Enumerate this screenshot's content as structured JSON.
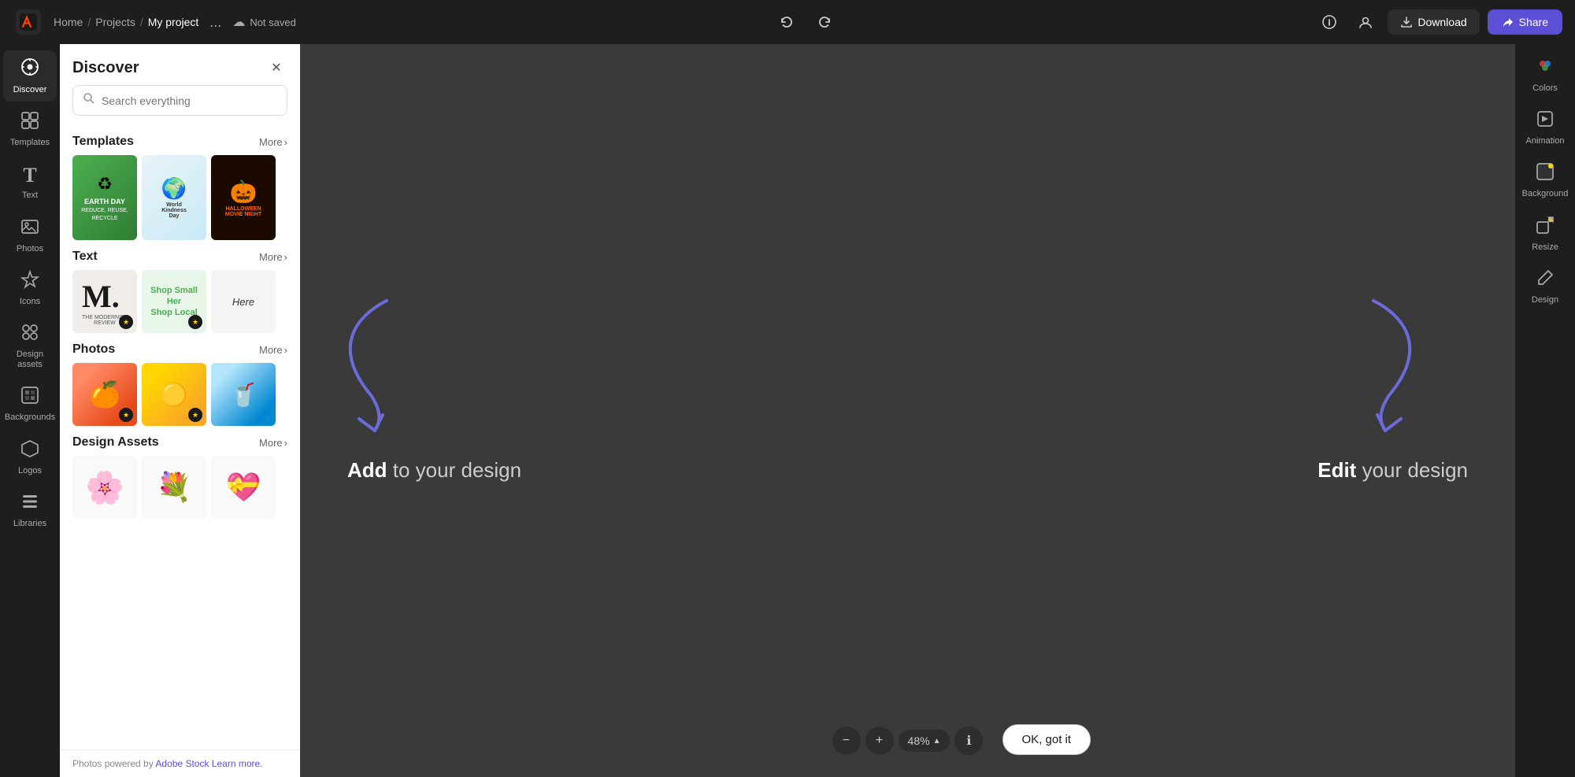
{
  "topbar": {
    "logo_alt": "Adobe Express Logo",
    "nav_home": "Home",
    "nav_sep1": "/",
    "nav_projects": "Projects",
    "nav_sep2": "/",
    "nav_current": "My project",
    "nav_more": "...",
    "save_status": "Not saved",
    "download_label": "Download",
    "share_label": "Share"
  },
  "left_sidebar": {
    "items": [
      {
        "id": "discover",
        "label": "Discover",
        "icon": "⊕",
        "active": true
      },
      {
        "id": "templates",
        "label": "Templates",
        "icon": "⊞"
      },
      {
        "id": "text",
        "label": "Text",
        "icon": "T"
      },
      {
        "id": "photos",
        "label": "Photos",
        "icon": "⬜"
      },
      {
        "id": "icons",
        "label": "Icons",
        "icon": "✦"
      },
      {
        "id": "design-assets",
        "label": "Design assets",
        "icon": "🎨"
      },
      {
        "id": "backgrounds",
        "label": "Backgrounds",
        "icon": "▦"
      },
      {
        "id": "logos",
        "label": "Logos",
        "icon": "⬡"
      },
      {
        "id": "libraries",
        "label": "Libraries",
        "icon": "≡"
      }
    ]
  },
  "discover_panel": {
    "title": "Discover",
    "close_label": "×",
    "search_placeholder": "Search everything",
    "sections": {
      "templates": {
        "title": "Templates",
        "more_label": "More",
        "items": [
          {
            "id": "earth-day",
            "label": "Earth Day"
          },
          {
            "id": "world-kindness",
            "label": "World Kindness Day"
          },
          {
            "id": "halloween-night",
            "label": "Halloween Movie Night"
          }
        ]
      },
      "text": {
        "title": "Text",
        "more_label": "More",
        "items": [
          {
            "id": "modernist",
            "label": "The Modernist Review"
          },
          {
            "id": "shop-small",
            "label": "Shop Small Her Shop Local"
          },
          {
            "id": "here",
            "label": "Here"
          }
        ]
      },
      "photos": {
        "title": "Photos",
        "more_label": "More",
        "items": [
          {
            "id": "food",
            "label": "Food photo"
          },
          {
            "id": "yellow",
            "label": "Yellow abstract"
          },
          {
            "id": "drink",
            "label": "Drink photo"
          }
        ]
      },
      "design_assets": {
        "title": "Design Assets",
        "more_label": "More",
        "items": [
          {
            "id": "flower1",
            "label": "Decorative flower 1"
          },
          {
            "id": "flower2",
            "label": "Decorative flower 2"
          },
          {
            "id": "heart",
            "label": "Heart design"
          }
        ]
      }
    },
    "footer": "Photos powered by ",
    "footer_brand": "Adobe Stock",
    "footer_link": "Learn more."
  },
  "main_canvas": {
    "hint_add": "Add",
    "hint_add_suffix": " to your design",
    "hint_edit": "Edit",
    "hint_edit_suffix": " your design"
  },
  "bottom_toolbar": {
    "zoom_out_label": "−",
    "zoom_in_label": "+",
    "zoom_level": "48%",
    "info_label": "ℹ",
    "ok_label": "OK, got it"
  },
  "right_sidebar": {
    "items": [
      {
        "id": "colors",
        "label": "Colors",
        "icon": "⬡"
      },
      {
        "id": "animation",
        "label": "Animation",
        "icon": "◈"
      },
      {
        "id": "background",
        "label": "Background",
        "icon": "⬜"
      },
      {
        "id": "resize",
        "label": "Resize",
        "icon": "⤡"
      },
      {
        "id": "design",
        "label": "Design",
        "icon": "✏"
      }
    ]
  }
}
